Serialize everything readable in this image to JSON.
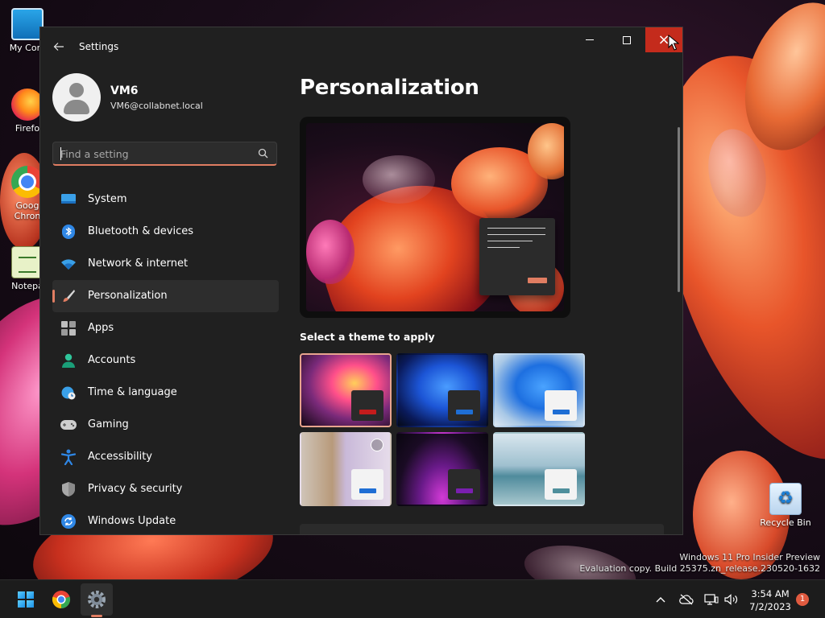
{
  "desktop": {
    "icons": [
      {
        "label": "My Com",
        "icon": "computer-icon"
      },
      {
        "label": "Firefo",
        "icon": "firefox-icon"
      },
      {
        "label": "Goog",
        "label2": "Chron",
        "icon": "chrome-icon"
      },
      {
        "label": "Notepa",
        "icon": "notepad-icon"
      },
      {
        "label": "Recycle Bin",
        "icon": "recycle-bin-icon"
      }
    ],
    "watermark_line1": "Windows 11 Pro Insider Preview",
    "watermark_line2": "Evaluation copy. Build 25375.zn_release.230520-1632"
  },
  "window": {
    "title": "Settings",
    "back_icon": "arrow-left-icon",
    "controls": {
      "minimize": "minimize-icon",
      "maximize": "maximize-icon",
      "close": "×"
    }
  },
  "profile": {
    "name": "VM6",
    "email": "VM6@collabnet.local"
  },
  "search": {
    "placeholder": "Find a setting",
    "value": "",
    "icon": "search-icon"
  },
  "nav": {
    "items": [
      {
        "label": "System",
        "icon": "monitor-icon",
        "selected": false
      },
      {
        "label": "Bluetooth & devices",
        "icon": "bluetooth-icon",
        "selected": false
      },
      {
        "label": "Network & internet",
        "icon": "wifi-icon",
        "selected": false
      },
      {
        "label": "Personalization",
        "icon": "brush-icon",
        "selected": true
      },
      {
        "label": "Apps",
        "icon": "apps-icon",
        "selected": false
      },
      {
        "label": "Accounts",
        "icon": "person-icon",
        "selected": false
      },
      {
        "label": "Time & language",
        "icon": "globe-clock-icon",
        "selected": false
      },
      {
        "label": "Gaming",
        "icon": "gamepad-icon",
        "selected": false
      },
      {
        "label": "Accessibility",
        "icon": "accessibility-icon",
        "selected": false
      },
      {
        "label": "Privacy & security",
        "icon": "shield-icon",
        "selected": false
      },
      {
        "label": "Windows Update",
        "icon": "sync-icon",
        "selected": false
      }
    ]
  },
  "main": {
    "title": "Personalization",
    "theme_section_title": "Select a theme to apply",
    "themes": [
      {
        "name": "theme-glow-dark",
        "active": true,
        "accent": "#c41c1c"
      },
      {
        "name": "theme-bloom-dark",
        "active": false,
        "accent": "#1f6ed4"
      },
      {
        "name": "theme-bloom-light",
        "active": false,
        "accent": "#1f6ed4"
      },
      {
        "name": "theme-spotlight",
        "active": false,
        "accent": "#1f6ed4"
      },
      {
        "name": "theme-glow-purple",
        "active": false,
        "accent": "#7a1fb0"
      },
      {
        "name": "theme-flow",
        "active": false,
        "accent": "#4f8f9c"
      }
    ]
  },
  "taskbar": {
    "apps": [
      {
        "name": "start",
        "icon": "windows-logo-icon"
      },
      {
        "name": "chrome",
        "icon": "chrome-icon"
      },
      {
        "name": "settings",
        "icon": "settings-gear-icon"
      }
    ],
    "tray_icons": [
      "chevron-up-icon",
      "cloud-offline-icon",
      "network-icon",
      "volume-icon"
    ],
    "time": "3:54 AM",
    "date": "7/2/2023",
    "notification_count": "1"
  },
  "colors": {
    "accent": "#e07d62",
    "window_bg": "#202020",
    "close_hover": "#c42b1c"
  }
}
